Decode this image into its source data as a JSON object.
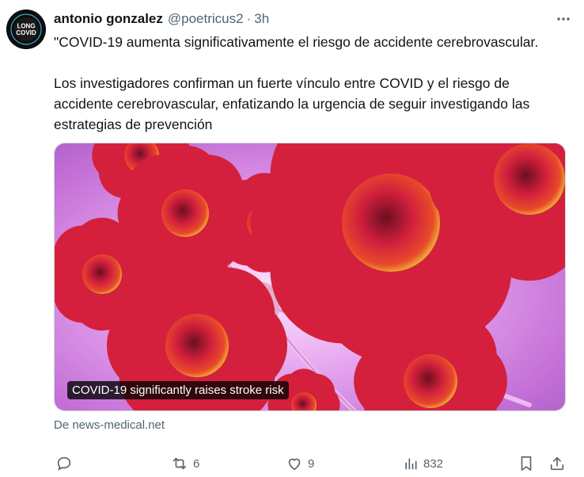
{
  "author": {
    "name": "antonio gonzalez",
    "handle": "@poetricus2",
    "separator": "·",
    "time": "3h",
    "avatar_text": [
      "LONG",
      "COVID"
    ]
  },
  "tweet_text": "\"COVID-19 aumenta significativamente el riesgo de accidente cerebrovascular.\n\nLos investigadores confirman un fuerte vínculo entre COVID y el riesgo de accidente cerebrovascular, enfatizando la urgencia de seguir investigando las estrategias de prevención",
  "media": {
    "caption": "COVID-19 significantly raises stroke risk"
  },
  "link_source": "De news-medical.net",
  "actions": {
    "reply_count": "",
    "retweet_count": "6",
    "like_count": "9",
    "views_count": "832"
  },
  "icons": {
    "more": "more-horizontal-icon",
    "reply": "reply-icon",
    "retweet": "retweet-icon",
    "like": "heart-icon",
    "views": "views-chart-icon",
    "bookmark": "bookmark-icon",
    "share": "share-icon"
  },
  "colors": {
    "text_primary": "#0f1419",
    "text_secondary": "#536471",
    "image_bg": "#d98ce8",
    "virus_red": "#c8203a",
    "virus_yellow": "#f2d23a"
  }
}
